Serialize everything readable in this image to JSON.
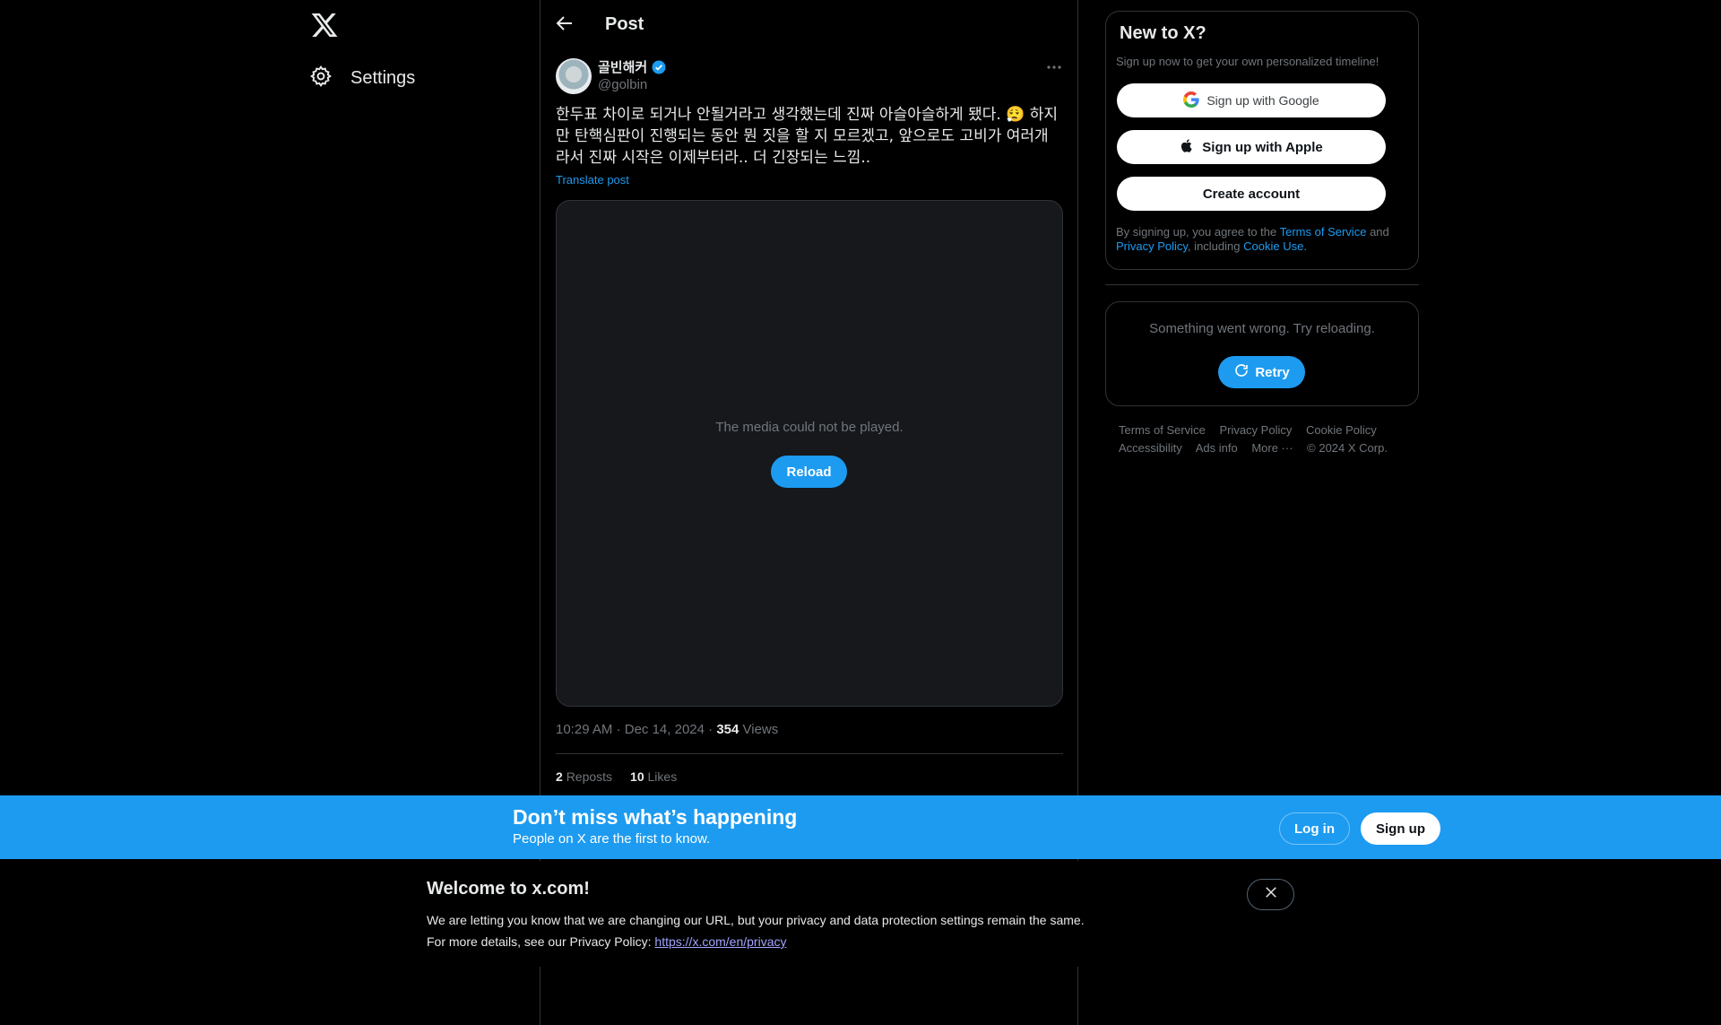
{
  "nav": {
    "settings_label": "Settings"
  },
  "header": {
    "title": "Post"
  },
  "post": {
    "author_name": "골빈해커",
    "handle": "@golbin",
    "text": "한두표 차이로 되거나 안될거라고 생각했는데 진짜 아슬아슬하게 됐다. 😮‍💨 하지만 탄핵심판이 진행되는 동안 뭔 짓을 할 지 모르겠고, 앞으로도 고비가 여러개라서 진짜 시작은 이제부터라.. 더 긴장되는 느낌..",
    "translate_label": "Translate post",
    "media_error": "The media could not be played.",
    "reload_label": "Reload",
    "time": "10:29 AM",
    "date": "Dec 14, 2024",
    "views_count": "354",
    "views_label": "Views",
    "reposts_count": "2",
    "reposts_label": "Reposts",
    "likes_count": "10",
    "likes_label": "Likes"
  },
  "sidebar": {
    "new_title": "New to X?",
    "new_sub": "Sign up now to get your own personalized timeline!",
    "google_label": "Sign up with Google",
    "apple_label": "Sign up with Apple",
    "create_label": "Create account",
    "terms_prefix": "By signing up, you agree to the",
    "terms_link": "Terms of Service",
    "terms_and": "and",
    "privacy_link": "Privacy Policy",
    "terms_including": ", including",
    "cookie_link": "Cookie Use.",
    "error_msg": "Something went wrong. Try reloading.",
    "retry_label": "Retry",
    "footer": [
      "Terms of Service",
      "Privacy Policy",
      "Cookie Policy",
      "Accessibility",
      "Ads info",
      "More ···",
      "© 2024 X Corp."
    ]
  },
  "banner": {
    "title": "Don’t miss what’s happening",
    "subtitle": "People on X are the first to know.",
    "login_label": "Log in",
    "signup_label": "Sign up"
  },
  "welcome": {
    "title": "Welcome to x.com!",
    "line1": "We are letting you know that we are changing our URL, but your privacy and data protection settings remain the same.",
    "line2_prefix": "For more details, see our Privacy Policy: ",
    "line2_link": "https://x.com/en/privacy"
  },
  "colors": {
    "accent": "#1d9bf0",
    "background": "#000000",
    "muted": "#71767b"
  }
}
